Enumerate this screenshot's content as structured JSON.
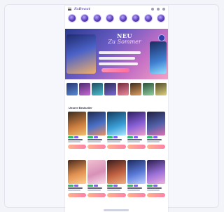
{
  "app": {
    "logo_text": "FaBeaut"
  },
  "topbar": {
    "link_text": ""
  },
  "hero": {
    "title": "NEU",
    "subtitle": "Zu Sommer"
  },
  "section": {
    "title": "Unsere Bestseller"
  },
  "colors": {
    "accent": "#7b5fcf",
    "button_gradient_start": "#ffb38a",
    "button_gradient_end": "#ff7fa8",
    "tag_green": "#2bbf6a"
  },
  "categories": [
    {
      "icon": "category-icon"
    },
    {
      "icon": "category-icon"
    },
    {
      "icon": "category-icon"
    },
    {
      "icon": "category-icon"
    },
    {
      "icon": "category-icon"
    },
    {
      "icon": "category-icon"
    },
    {
      "icon": "category-icon"
    },
    {
      "icon": "category-icon"
    }
  ]
}
